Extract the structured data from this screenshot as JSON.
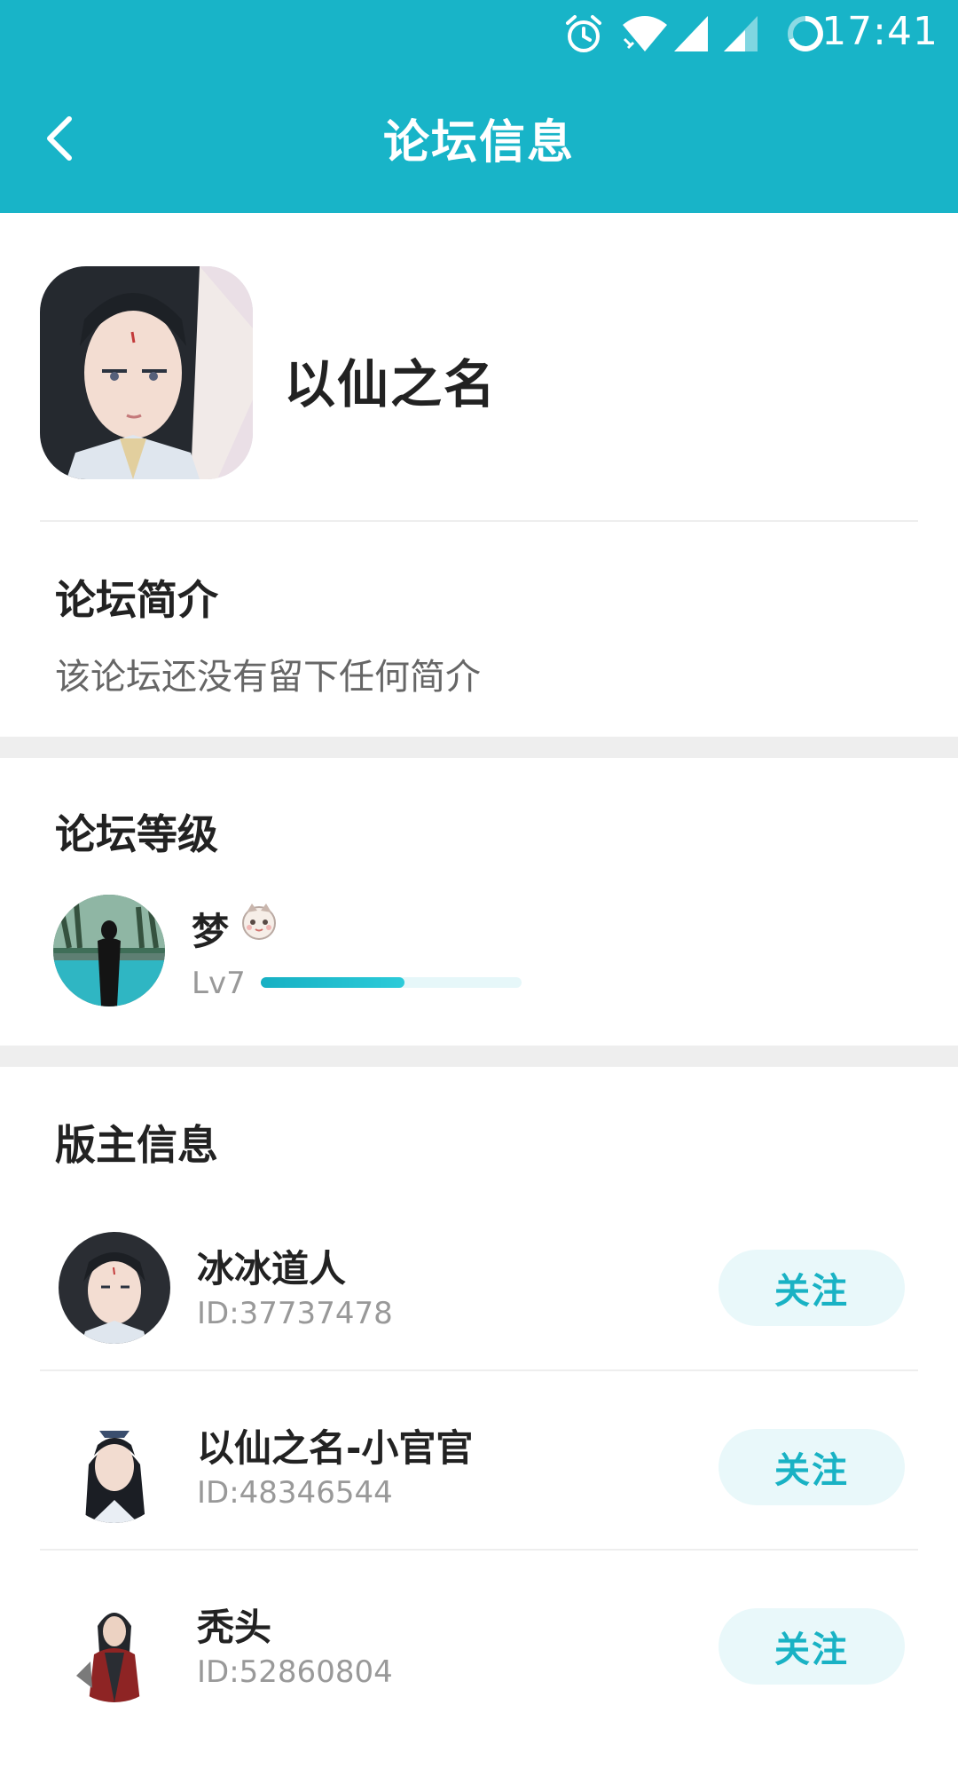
{
  "status_bar": {
    "time": "17:41",
    "icons": [
      "alarm-icon",
      "wifi-icon",
      "signal-icon",
      "signal-icon",
      "loading-ring-icon"
    ]
  },
  "header": {
    "title": "论坛信息",
    "back_icon": "chevron-left-icon"
  },
  "forum": {
    "name": "以仙之名"
  },
  "intro": {
    "title": "论坛简介",
    "text": "该论坛还没有留下任何简介"
  },
  "level": {
    "title": "论坛等级",
    "user_name": "梦",
    "badge_icon": "cartoon-badge-icon",
    "level_label": "Lv7",
    "progress": 0.55
  },
  "moderators": {
    "title": "版主信息",
    "items": [
      {
        "name": "冰冰道人",
        "id_text": "ID:37737478",
        "follow_label": "关注"
      },
      {
        "name": "以仙之名-小官官",
        "id_text": "ID:48346544",
        "follow_label": "关注"
      },
      {
        "name": "秃头",
        "id_text": "ID:52860804",
        "follow_label": "关注"
      }
    ]
  },
  "colors": {
    "header_bg": "#18b4c8",
    "accent": "#19b2c4",
    "follow_bg": "#e9f8fa",
    "section_gap": "#eeeeee"
  }
}
